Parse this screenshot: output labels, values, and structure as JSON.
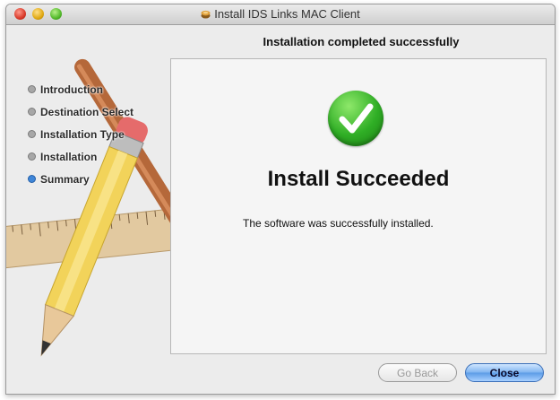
{
  "window": {
    "title": "Install IDS Links MAC Client"
  },
  "header": {
    "heading": "Installation completed successfully"
  },
  "sidebar": {
    "steps": [
      {
        "label": "Introduction",
        "active": false
      },
      {
        "label": "Destination Select",
        "active": false
      },
      {
        "label": "Installation Type",
        "active": false
      },
      {
        "label": "Installation",
        "active": false
      },
      {
        "label": "Summary",
        "active": true
      }
    ]
  },
  "main": {
    "result_title": "Install Succeeded",
    "result_message": "The software was successfully installed."
  },
  "buttons": {
    "back_label": "Go Back",
    "close_label": "Close"
  },
  "colors": {
    "success_green": "#2fae25",
    "active_step_blue": "#3f86d8",
    "default_button_blue": "#5a9be6"
  }
}
